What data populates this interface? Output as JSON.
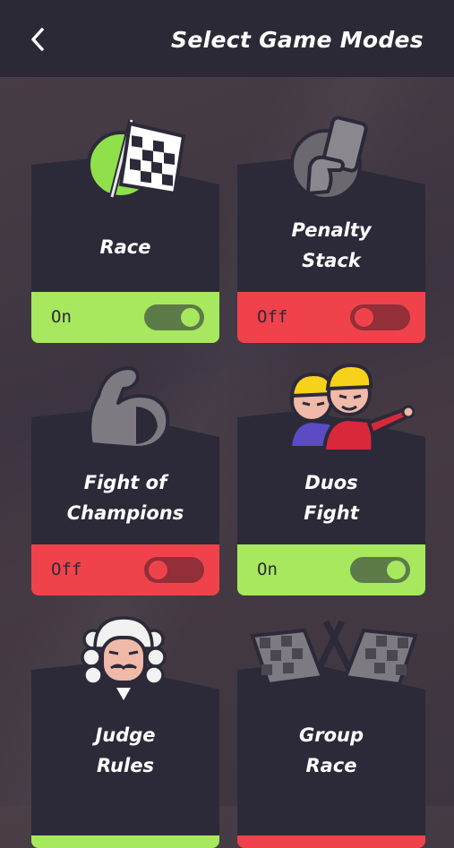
{
  "header": {
    "title": "Select Game Modes",
    "back_icon": "chevron-left-icon"
  },
  "modes": [
    {
      "line1": "Race",
      "line2": "",
      "status": "On",
      "enabled": true,
      "icon": "checkered-flag-icon"
    },
    {
      "line1": "Penalty",
      "line2": "Stack",
      "status": "Off",
      "enabled": false,
      "icon": "hand-card-icon"
    },
    {
      "line1": "Fight of",
      "line2": "Champions",
      "status": "Off",
      "enabled": false,
      "icon": "flexed-arm-icon"
    },
    {
      "line1": "Duos",
      "line2": "Fight",
      "status": "On",
      "enabled": true,
      "icon": "duo-fighters-icon"
    },
    {
      "line1": "Judge",
      "line2": "Rules",
      "status": "",
      "enabled": true,
      "icon": "judge-icon"
    },
    {
      "line1": "Group",
      "line2": "Race",
      "status": "",
      "enabled": false,
      "icon": "crossed-flags-icon"
    }
  ],
  "colors": {
    "on": "#a7e85e",
    "off": "#f0424b",
    "panel": "#2c2a39",
    "header": "#2c2937"
  }
}
